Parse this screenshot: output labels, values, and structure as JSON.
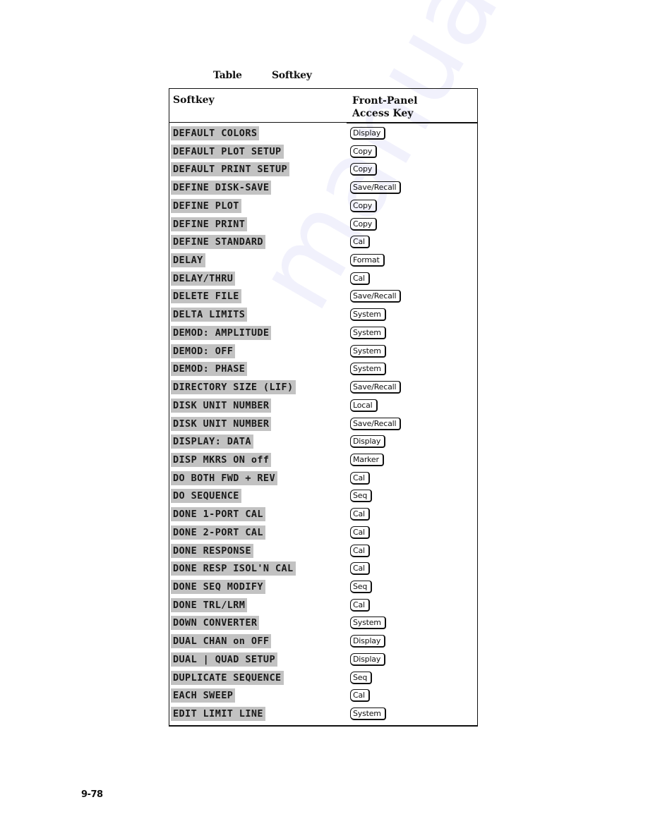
{
  "caption": {
    "table_label": "Table",
    "title": "Softkey"
  },
  "table": {
    "headers": {
      "softkey": "Softkey",
      "access_key_line1": "Front-Panel",
      "access_key_line2": "Access Key"
    },
    "rows": [
      {
        "softkey": "DEFAULT COLORS",
        "key": "Display"
      },
      {
        "softkey": "DEFAULT PLOT SETUP",
        "key": "Copy"
      },
      {
        "softkey": "DEFAULT PRINT SETUP",
        "key": "Copy"
      },
      {
        "softkey": "DEFINE DISK-SAVE",
        "key": "Save/Recall"
      },
      {
        "softkey": "DEFINE PLOT",
        "key": "Copy"
      },
      {
        "softkey": "DEFINE PRINT",
        "key": "Copy"
      },
      {
        "softkey": "DEFINE STANDARD",
        "key": "Cal"
      },
      {
        "softkey": "DELAY",
        "key": "Format"
      },
      {
        "softkey": "DELAY/THRU",
        "key": "Cal"
      },
      {
        "softkey": "DELETE FILE",
        "key": "Save/Recall"
      },
      {
        "softkey": "DELTA LIMITS",
        "key": "System"
      },
      {
        "softkey": "DEMOD: AMPLITUDE",
        "key": "System"
      },
      {
        "softkey": "DEMOD: OFF",
        "key": "System"
      },
      {
        "softkey": "DEMOD: PHASE",
        "key": "System"
      },
      {
        "softkey": "DIRECTORY SIZE (LIF)",
        "key": "Save/Recall"
      },
      {
        "softkey": "DISK UNIT NUMBER",
        "key": "Local"
      },
      {
        "softkey": "DISK UNIT NUMBER",
        "key": "Save/Recall"
      },
      {
        "softkey": "DISPLAY: DATA",
        "key": "Display"
      },
      {
        "softkey": "DISP MKRS ON off",
        "key": "Marker"
      },
      {
        "softkey": "DO BOTH FWD + REV",
        "key": "Cal"
      },
      {
        "softkey": "DO SEQUENCE",
        "key": "Seq"
      },
      {
        "softkey": "DONE 1-PORT CAL",
        "key": "Cal"
      },
      {
        "softkey": "DONE 2-PORT CAL",
        "key": "Cal"
      },
      {
        "softkey": "DONE RESPONSE",
        "key": "Cal"
      },
      {
        "softkey": "DONE RESP ISOL'N CAL",
        "key": "Cal"
      },
      {
        "softkey": "DONE SEQ MODIFY",
        "key": "Seq"
      },
      {
        "softkey": "DONE TRL/LRM",
        "key": "Cal"
      },
      {
        "softkey": "DOWN CONVERTER",
        "key": "System"
      },
      {
        "softkey": "DUAL CHAN on OFF",
        "key": "Display"
      },
      {
        "softkey": "DUAL | QUAD SETUP",
        "key": "Display"
      },
      {
        "softkey": "DUPLICATE SEQUENCE",
        "key": "Seq"
      },
      {
        "softkey": "EACH SWEEP",
        "key": "Cal"
      },
      {
        "softkey": "EDIT LIMIT LINE",
        "key": "System"
      }
    ]
  },
  "page_number": "9-78",
  "watermark": "manualshive.com"
}
